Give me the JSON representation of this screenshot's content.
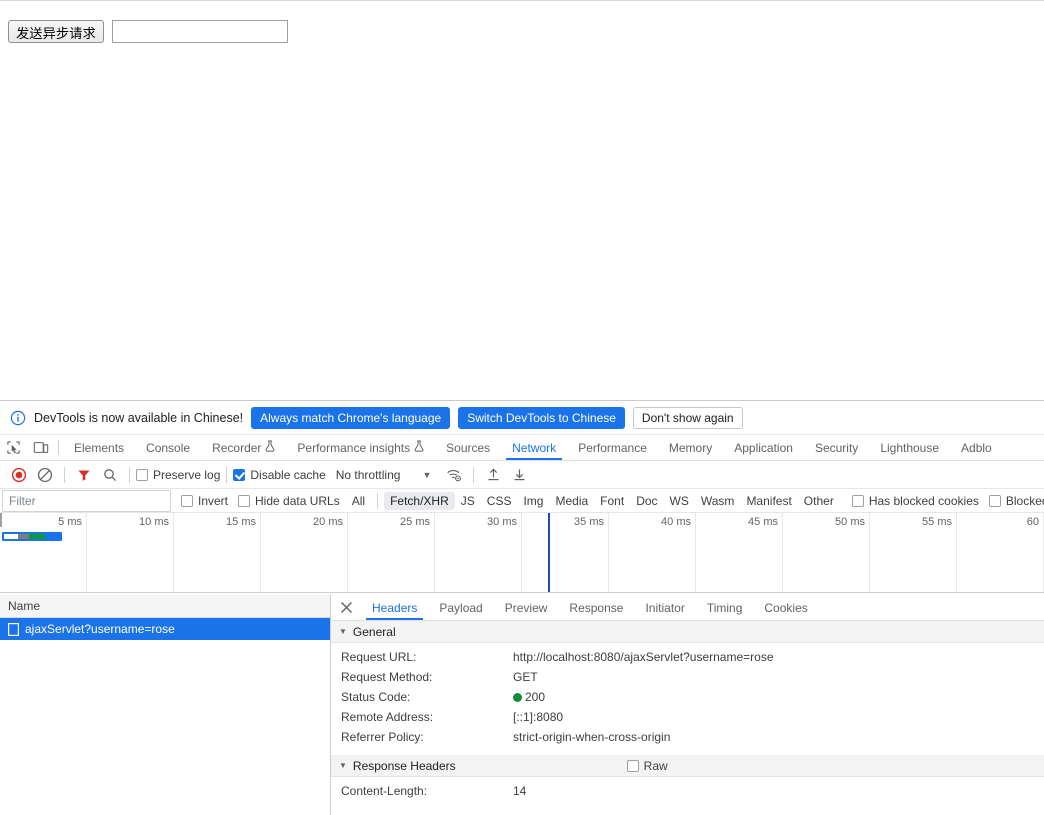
{
  "page": {
    "send_button_label": "发送异步请求",
    "text_input_value": "",
    "text_input_placeholder": ""
  },
  "notification": {
    "icon": "info-icon",
    "message": "DevTools is now available in Chinese!",
    "primary_button": "Always match Chrome's language",
    "secondary_button": "Switch DevTools to Chinese",
    "dismiss_button": "Don't show again"
  },
  "main_tabs": {
    "items": [
      {
        "label": "Elements",
        "active": false,
        "flask": false
      },
      {
        "label": "Console",
        "active": false,
        "flask": false
      },
      {
        "label": "Recorder",
        "active": false,
        "flask": true
      },
      {
        "label": "Performance insights",
        "active": false,
        "flask": true
      },
      {
        "label": "Sources",
        "active": false,
        "flask": false
      },
      {
        "label": "Network",
        "active": true,
        "flask": false
      },
      {
        "label": "Performance",
        "active": false,
        "flask": false
      },
      {
        "label": "Memory",
        "active": false,
        "flask": false
      },
      {
        "label": "Application",
        "active": false,
        "flask": false
      },
      {
        "label": "Security",
        "active": false,
        "flask": false
      },
      {
        "label": "Lighthouse",
        "active": false,
        "flask": false
      },
      {
        "label": "Adblo",
        "active": false,
        "flask": false
      }
    ]
  },
  "network_toolbar": {
    "record_icon": "record-icon",
    "clear_icon": "clear-icon",
    "filter_icon": "filter-icon",
    "search_icon": "search-icon",
    "preserve_log_label": "Preserve log",
    "preserve_log_checked": false,
    "disable_cache_label": "Disable cache",
    "disable_cache_checked": true,
    "throttling_value": "No throttling",
    "wifi_icon": "wifi-settings-icon",
    "import_icon": "import-har-icon",
    "export_icon": "export-har-icon"
  },
  "filter_row": {
    "filter_placeholder": "Filter",
    "filter_value": "",
    "invert_label": "Invert",
    "invert_checked": false,
    "hide_data_urls_label": "Hide data URLs",
    "hide_data_urls_checked": false,
    "types": [
      {
        "label": "All",
        "selected": false
      },
      {
        "label": "Fetch/XHR",
        "selected": true
      },
      {
        "label": "JS",
        "selected": false
      },
      {
        "label": "CSS",
        "selected": false
      },
      {
        "label": "Img",
        "selected": false
      },
      {
        "label": "Media",
        "selected": false
      },
      {
        "label": "Font",
        "selected": false
      },
      {
        "label": "Doc",
        "selected": false
      },
      {
        "label": "WS",
        "selected": false
      },
      {
        "label": "Wasm",
        "selected": false
      },
      {
        "label": "Manifest",
        "selected": false
      },
      {
        "label": "Other",
        "selected": false
      }
    ],
    "has_blocked_cookies_label": "Has blocked cookies",
    "has_blocked_cookies_checked": false,
    "blocked_requests_label": "Blocked Requests",
    "blocked_requests_checked": false
  },
  "overview": {
    "tick_labels": [
      "5 ms",
      "10 ms",
      "15 ms",
      "20 ms",
      "25 ms",
      "30 ms",
      "35 ms",
      "40 ms",
      "45 ms",
      "50 ms",
      "55 ms",
      "60"
    ],
    "request_bar": {
      "color_border": "#1a73e8",
      "color_waiting": "#7d7d7d",
      "color_download": "#0a9a3c"
    },
    "dcl_marker_color": "#1a4fba"
  },
  "request_list": {
    "column_header": "Name",
    "rows": [
      {
        "name": "ajaxServlet?username=rose",
        "selected": true,
        "icon": "document-icon"
      }
    ]
  },
  "details": {
    "close_icon": "close-icon",
    "tabs": [
      {
        "label": "Headers",
        "active": true
      },
      {
        "label": "Payload",
        "active": false
      },
      {
        "label": "Preview",
        "active": false
      },
      {
        "label": "Response",
        "active": false
      },
      {
        "label": "Initiator",
        "active": false
      },
      {
        "label": "Timing",
        "active": false
      },
      {
        "label": "Cookies",
        "active": false
      }
    ],
    "general": {
      "section_title": "General",
      "rows": [
        {
          "key": "Request URL:",
          "value": "http://localhost:8080/ajaxServlet?username=rose",
          "status_dot": false
        },
        {
          "key": "Request Method:",
          "value": "GET",
          "status_dot": false
        },
        {
          "key": "Status Code:",
          "value": "200",
          "status_dot": true
        },
        {
          "key": "Remote Address:",
          "value": "[::1]:8080",
          "status_dot": false
        },
        {
          "key": "Referrer Policy:",
          "value": "strict-origin-when-cross-origin",
          "status_dot": false
        }
      ]
    },
    "response_headers": {
      "section_title": "Response Headers",
      "raw_label": "Raw",
      "raw_checked": false,
      "rows": [
        {
          "key": "Content-Length:",
          "value": "14"
        }
      ]
    }
  },
  "colors": {
    "accent": "#1a73e8",
    "status_ok": "#128a3a",
    "selected_row": "#1a73e8"
  }
}
